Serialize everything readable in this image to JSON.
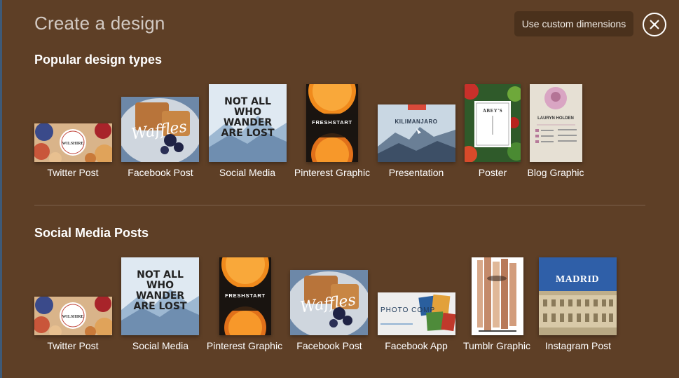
{
  "header": {
    "title": "Create a design",
    "custom_dimensions_label": "Use custom dimensions"
  },
  "icons": {
    "close": "close-icon"
  },
  "sections": [
    {
      "title": "Popular design types",
      "items": [
        {
          "label": "Twitter Post",
          "thumb_text": "WILSHIRE"
        },
        {
          "label": "Facebook Post",
          "thumb_text": "Waffles"
        },
        {
          "label": "Social Media",
          "thumb_text": "NOT ALL WHO WANDER ARE LOST"
        },
        {
          "label": "Pinterest Graphic",
          "thumb_text": "FRESHSTART"
        },
        {
          "label": "Presentation",
          "thumb_text": "KILIMANJARO"
        },
        {
          "label": "Poster",
          "thumb_text": "ABEY'S"
        },
        {
          "label": "Blog Graphic",
          "thumb_text": "LAURYN HOLDEN"
        }
      ]
    },
    {
      "title": "Social Media Posts",
      "items": [
        {
          "label": "Twitter Post",
          "thumb_text": "WILSHIRE"
        },
        {
          "label": "Social Media",
          "thumb_text": "NOT ALL WHO WANDER ARE LOST"
        },
        {
          "label": "Pinterest Graphic",
          "thumb_text": "FRESHSTART"
        },
        {
          "label": "Facebook Post",
          "thumb_text": "Waffles"
        },
        {
          "label": "Facebook App",
          "thumb_text": "PHOTO COMP"
        },
        {
          "label": "Tumblr Graphic",
          "thumb_text": ""
        },
        {
          "label": "Instagram Post",
          "thumb_text": "MADRID"
        }
      ]
    }
  ],
  "colors": {
    "background": "#5e3f26",
    "button": "#4a311c"
  }
}
